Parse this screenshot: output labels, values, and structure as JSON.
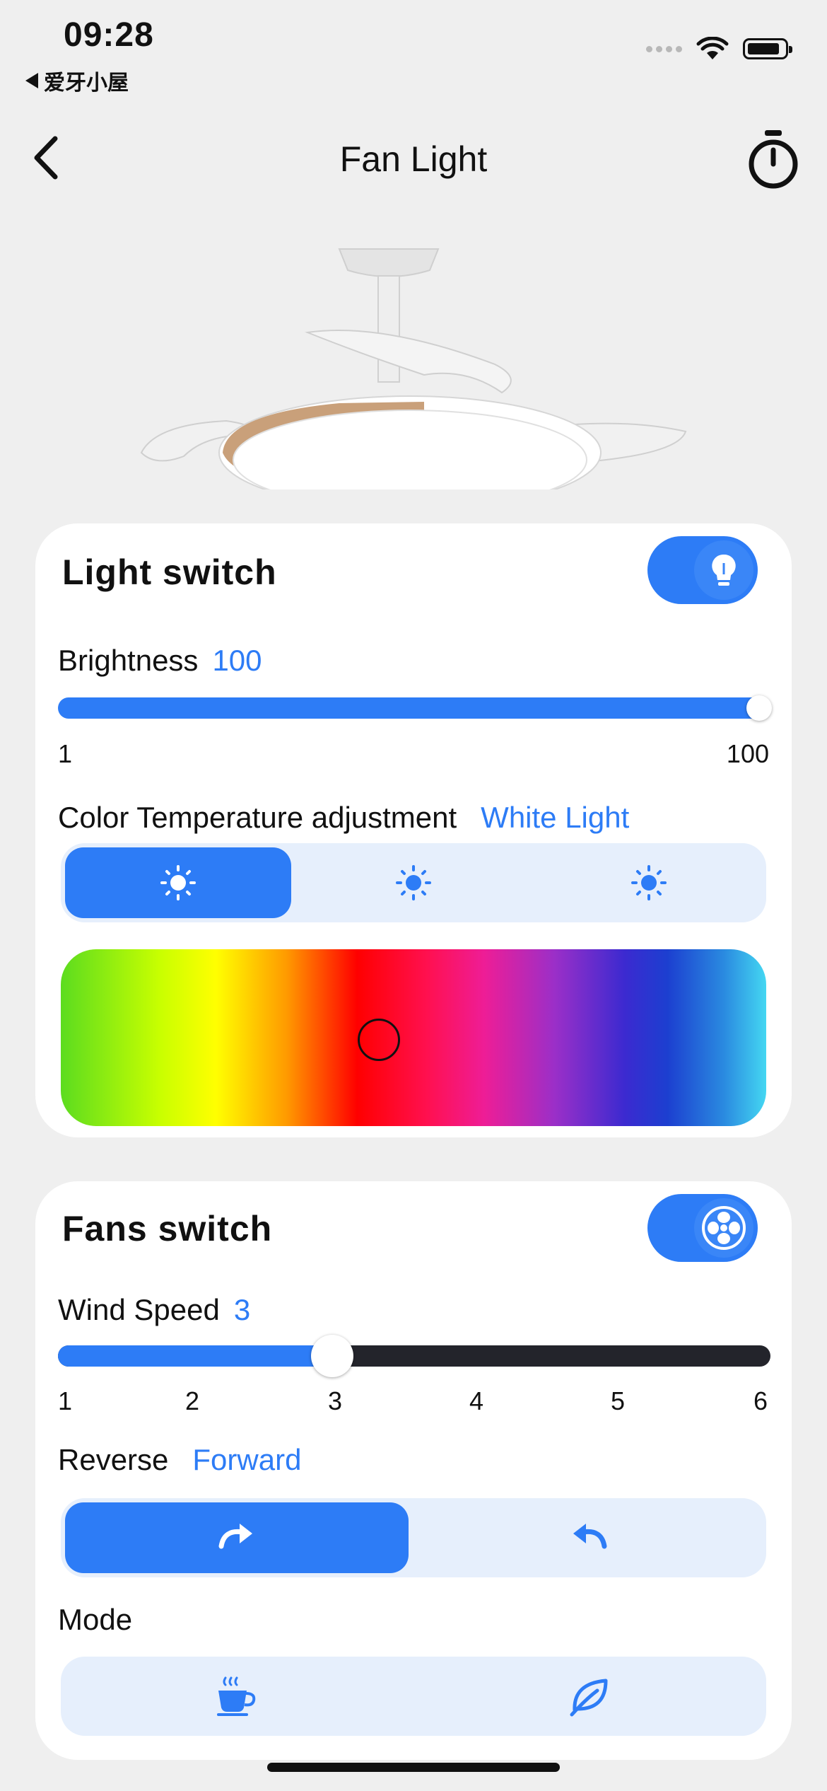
{
  "status_bar": {
    "time": "09:28",
    "back_app": "爱牙小屋"
  },
  "header": {
    "title": "Fan Light",
    "back_icon": "chevron-left-icon",
    "timer_icon": "stopwatch-icon"
  },
  "light": {
    "title": "Light switch",
    "on": true,
    "toggle_icon": "lightbulb-icon",
    "brightness_label": "Brightness",
    "brightness_value": "100",
    "brightness_min": "1",
    "brightness_max": "100",
    "brightness_fraction": 1.0,
    "color_temp_label": "Color Temperature adjustment",
    "color_temp_value": "White Light",
    "color_temp_options": [
      "white-light-sun-icon",
      "neutral-light-sun-icon",
      "warm-light-sun-icon"
    ],
    "color_temp_selected": 0,
    "spectrum_selected_hue": "red"
  },
  "fan": {
    "title": "Fans switch",
    "on": true,
    "toggle_icon": "fan-icon",
    "wind_speed_label": "Wind Speed",
    "wind_speed_value": "3",
    "wind_speed_ticks": [
      "1",
      "2",
      "3",
      "4",
      "5",
      "6"
    ],
    "reverse_label": "Reverse",
    "reverse_value": "Forward",
    "direction_options": [
      "clockwise-arrow-icon",
      "counterclockwise-arrow-icon"
    ],
    "direction_selected": 0,
    "mode_label": "Mode",
    "mode_options": [
      "hot-cup-icon",
      "leaf-icon"
    ]
  },
  "colors": {
    "accent": "#2d7cf6",
    "segment_bg": "#e6effc",
    "track_dark": "#23242b",
    "background": "#efefef"
  }
}
